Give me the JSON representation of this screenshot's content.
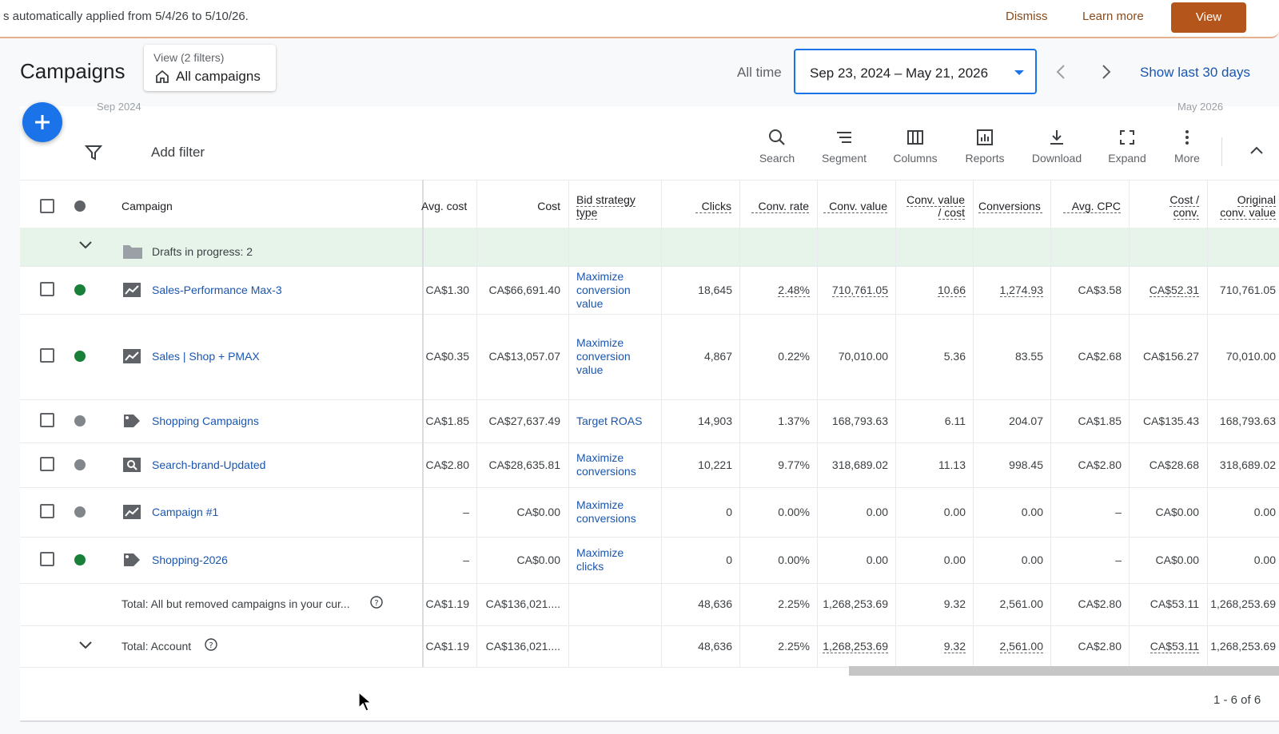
{
  "banner": {
    "text": "s automatically applied from 5/4/26 to 5/10/26.",
    "dismiss": "Dismiss",
    "learn_more": "Learn more",
    "view": "View"
  },
  "header": {
    "title": "Campaigns",
    "view_label": "View (2 filters)",
    "view_value": "All campaigns",
    "all_time": "All time",
    "date_range": "Sep 23, 2024 – May 21, 2026",
    "show_last": "Show last 30 days",
    "timeline_start": "Sep 2024",
    "timeline_end": "May 2026"
  },
  "toolbar": {
    "add_filter": "Add filter",
    "search": "Search",
    "segment": "Segment",
    "columns": "Columns",
    "reports": "Reports",
    "download": "Download",
    "expand": "Expand",
    "more": "More"
  },
  "table": {
    "headers": {
      "campaign": "Campaign",
      "avg_cost": "Avg. cost",
      "cost": "Cost",
      "bid_strategy_1": "Bid strategy",
      "bid_strategy_2": "type",
      "clicks": "Clicks",
      "conv_rate": "Conv. rate",
      "conv_value": "Conv. value",
      "cv_cost_1": "Conv. value",
      "cv_cost_2": "/ cost",
      "conversions": "Conversions",
      "avg_cpc": "Avg. CPC",
      "cost_conv_1": "Cost /",
      "cost_conv_2": "conv.",
      "orig_1": "Original",
      "orig_2": "conv. value"
    },
    "drafts": "Drafts in progress: 2",
    "rows": [
      {
        "name": "Sales-Performance Max-3",
        "status": "enabled",
        "avg_cost": "CA$1.30",
        "cost": "CA$66,691.40",
        "bid": [
          "Maximize",
          "conversion",
          "value"
        ],
        "clicks": "18,645",
        "conv_rate": "2.48%",
        "conv_value": "710,761.05",
        "cv_cost": "10.66",
        "conversions": "1,274.93",
        "avg_cpc": "CA$3.58",
        "cost_conv": "CA$52.31",
        "orig": "710,761.05"
      },
      {
        "name": "Sales | Shop + PMAX",
        "status": "enabled",
        "avg_cost": "CA$0.35",
        "cost": "CA$13,057.07",
        "bid": [
          "Maximize",
          "conversion",
          "value"
        ],
        "clicks": "4,867",
        "conv_rate": "0.22%",
        "conv_value": "70,010.00",
        "cv_cost": "5.36",
        "conversions": "83.55",
        "avg_cpc": "CA$2.68",
        "cost_conv": "CA$156.27",
        "orig": "70,010.00"
      },
      {
        "name": "Shopping Campaigns",
        "status": "paused",
        "avg_cost": "CA$1.85",
        "cost": "CA$27,637.49",
        "bid": [
          "Target ROAS"
        ],
        "clicks": "14,903",
        "conv_rate": "1.37%",
        "conv_value": "168,793.63",
        "cv_cost": "6.11",
        "conversions": "204.07",
        "avg_cpc": "CA$1.85",
        "cost_conv": "CA$135.43",
        "orig": "168,793.63"
      },
      {
        "name": "Search-brand-Updated",
        "status": "paused",
        "avg_cost": "CA$2.80",
        "cost": "CA$28,635.81",
        "bid": [
          "Maximize",
          "conversions"
        ],
        "clicks": "10,221",
        "conv_rate": "9.77%",
        "conv_value": "318,689.02",
        "cv_cost": "11.13",
        "conversions": "998.45",
        "avg_cpc": "CA$2.80",
        "cost_conv": "CA$28.68",
        "orig": "318,689.02"
      },
      {
        "name": "Campaign #1",
        "status": "paused",
        "avg_cost": "–",
        "cost": "CA$0.00",
        "bid": [
          "Maximize",
          "conversions"
        ],
        "clicks": "0",
        "conv_rate": "0.00%",
        "conv_value": "0.00",
        "cv_cost": "0.00",
        "conversions": "0.00",
        "avg_cpc": "–",
        "cost_conv": "CA$0.00",
        "orig": "0.00"
      },
      {
        "name": "Shopping-2026",
        "status": "enabled",
        "avg_cost": "–",
        "cost": "CA$0.00",
        "bid": [
          "Maximize",
          "clicks"
        ],
        "clicks": "0",
        "conv_rate": "0.00%",
        "conv_value": "0.00",
        "cv_cost": "0.00",
        "conversions": "0.00",
        "avg_cpc": "–",
        "cost_conv": "CA$0.00",
        "orig": "0.00"
      }
    ],
    "total_campaigns": {
      "label": "Total: All but removed campaigns in your cur...",
      "avg_cost": "CA$1.19",
      "cost": "CA$136,021....",
      "clicks": "48,636",
      "conv_rate": "2.25%",
      "conv_value": "1,268,253.69",
      "cv_cost": "9.32",
      "conversions": "2,561.00",
      "avg_cpc": "CA$2.80",
      "cost_conv": "CA$53.11",
      "orig": "1,268,253.69"
    },
    "total_account": {
      "label": "Total: Account",
      "avg_cost": "CA$1.19",
      "cost": "CA$136,021....",
      "clicks": "48,636",
      "conv_rate": "2.25%",
      "conv_value": "1,268,253.69",
      "cv_cost": "9.32",
      "conversions": "2,561.00",
      "avg_cpc": "CA$2.80",
      "cost_conv": "CA$53.11",
      "orig": "1,268,253.69"
    }
  },
  "pagination": "1 - 6 of 6",
  "colors": {
    "accent": "#1a73e8",
    "link": "#1a56b0",
    "banner_button": "#b4551b",
    "enabled": "#188038",
    "drafts_bg": "#e6f4ea"
  }
}
